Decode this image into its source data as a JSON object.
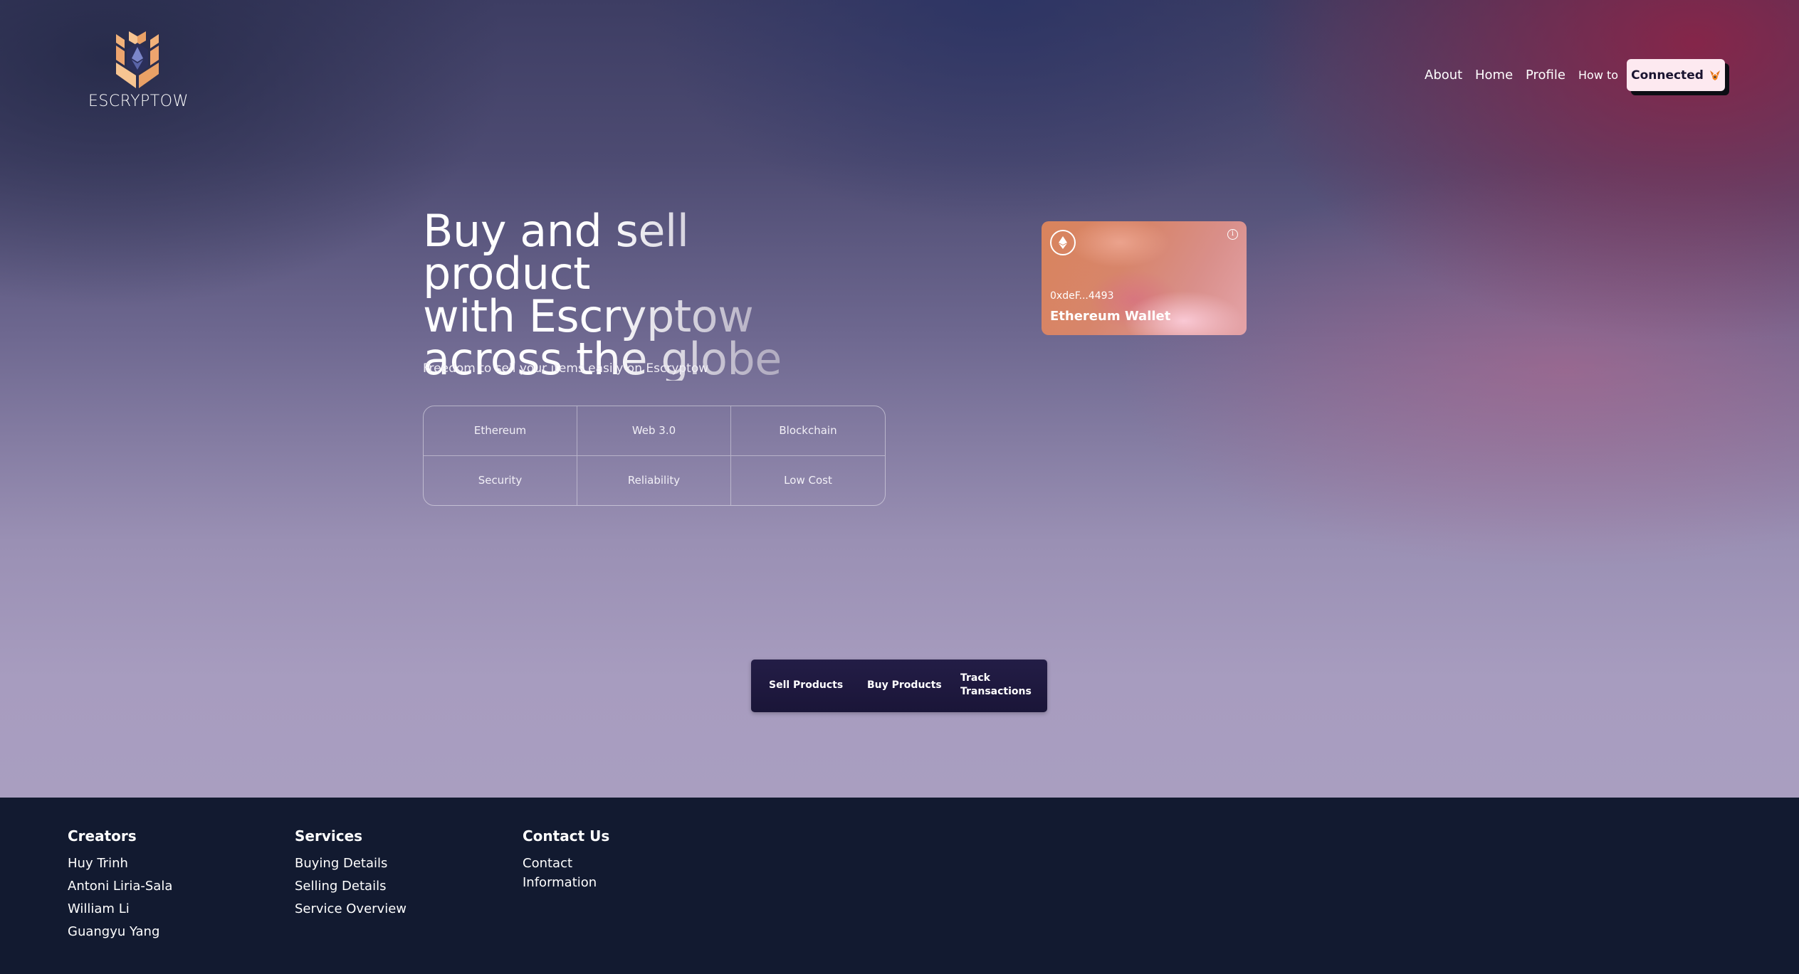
{
  "brand": {
    "name": "ESCRYPTOW"
  },
  "nav": {
    "links": [
      "About",
      "Home",
      "Profile",
      "How to"
    ],
    "connect_label": "Connected",
    "connect_icon": "metamask-fox-icon"
  },
  "hero": {
    "headline_lines": [
      "Buy and sell product",
      "with Escryptow",
      "across the globe"
    ],
    "subtitle": "Freedom to sell your items easily on Escryptow",
    "features": [
      "Ethereum",
      "Web 3.0",
      "Blockchain",
      "Security",
      "Reliability",
      "Low Cost"
    ]
  },
  "wallet": {
    "address": "0xdeF...4493",
    "name": "Ethereum Wallet",
    "icon": "ethereum-icon",
    "info_icon": "info-icon"
  },
  "actions": {
    "sell": "Sell Products",
    "buy": "Buy Products",
    "track_line1": "Track",
    "track_line2": "Transactions"
  },
  "footer": {
    "creators": {
      "title": "Creators",
      "items": [
        "Huy Trinh",
        "Antoni Liria-Sala",
        "William Li",
        "Guangyu Yang"
      ]
    },
    "services": {
      "title": "Services",
      "items": [
        "Buying Details",
        "Selling Details",
        "Service Overview"
      ]
    },
    "contact": {
      "title": "Contact Us",
      "items": [
        "Contact Information"
      ]
    }
  },
  "colors": {
    "footer_bg": "#121a30",
    "action_bar_bg": "#1a1538",
    "connect_bg": "#fde9f0",
    "logo_orange": "#f2b27a"
  }
}
